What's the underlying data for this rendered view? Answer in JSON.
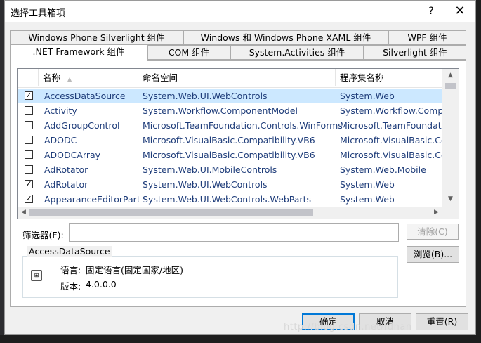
{
  "dialog": {
    "title": "选择工具箱项"
  },
  "titlebar": {
    "help": "?",
    "close": "✕"
  },
  "tabs_row1": [
    "Windows Phone Silverlight 组件",
    "Windows 和 Windows Phone XAML 组件",
    "WPF 组件"
  ],
  "tabs_row2": [
    ".NET Framework 组件",
    "COM 组件",
    "System.Activities 组件",
    "Silverlight 组件"
  ],
  "list": {
    "headers": [
      "名称",
      "命名空间",
      "程序集名称"
    ],
    "rows": [
      {
        "checked": true,
        "name": "AccessDataSource",
        "namespace": "System.Web.UI.WebControls",
        "assembly": "System.Web"
      },
      {
        "checked": false,
        "name": "Activity",
        "namespace": "System.Workflow.ComponentModel",
        "assembly": "System.Workflow.Compone"
      },
      {
        "checked": false,
        "name": "AddGroupControl",
        "namespace": "Microsoft.TeamFoundation.Controls.WinForms",
        "assembly": "Microsoft.TeamFoundatio"
      },
      {
        "checked": false,
        "name": "ADODC",
        "namespace": "Microsoft.VisualBasic.Compatibility.VB6",
        "assembly": "Microsoft.VisualBasic.Co"
      },
      {
        "checked": false,
        "name": "ADODCArray",
        "namespace": "Microsoft.VisualBasic.Compatibility.VB6",
        "assembly": "Microsoft.VisualBasic.Co"
      },
      {
        "checked": false,
        "name": "AdRotator",
        "namespace": "System.Web.UI.MobileControls",
        "assembly": "System.Web.Mobile"
      },
      {
        "checked": true,
        "name": "AdRotator",
        "namespace": "System.Web.UI.WebControls",
        "assembly": "System.Web"
      },
      {
        "checked": true,
        "name": "AppearanceEditorPart",
        "namespace": "System.Web.UI.WebControls.WebParts",
        "assembly": "System.Web"
      }
    ]
  },
  "filter": {
    "label": "筛选器(F):",
    "value": "",
    "clear": "清除(C)"
  },
  "details": {
    "group_title": "AccessDataSource",
    "language_label": "语言:",
    "language_value": "固定语言(固定国家/地区)",
    "version_label": "版本:",
    "version_value": "4.0.0.0",
    "icon": "assembly-icon"
  },
  "buttons": {
    "browse": "浏览(B)...",
    "ok": "确定",
    "cancel": "取消",
    "reset": "重置(R)"
  },
  "watermark": "http://blog.csdn.net/fdhan",
  "colors": {
    "selection": "#cce8ff",
    "link_text": "#1f3d7a",
    "ok_border": "#0078d7"
  }
}
